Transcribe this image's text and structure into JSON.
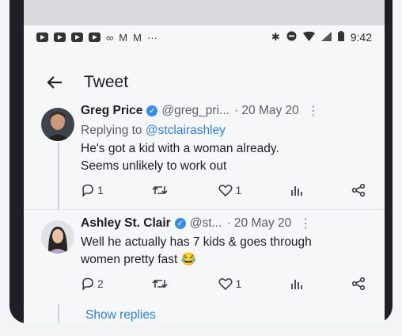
{
  "status_bar": {
    "time": "9:42",
    "icons": [
      "youtube-icon",
      "youtube-icon",
      "youtube-icon",
      "youtube-icon",
      "voicemail-icon",
      "gmail-icon",
      "gmail-icon",
      "more-dots-icon",
      "bluetooth-icon",
      "dnd-icon",
      "wifi-icon",
      "signal-icon",
      "battery-icon"
    ],
    "more_glyph": "···"
  },
  "header": {
    "title": "Tweet"
  },
  "tweets": [
    {
      "name": "Greg Price",
      "handle": "@greg_pri...",
      "date": "· 20 May 20",
      "replying_prefix": "Replying to ",
      "replying_handle": "@stclairashley",
      "text_line1": "He's got a kid with a woman already.",
      "text_line2": "Seems unlikely to work out",
      "replies": "1",
      "retweets": "",
      "likes": "1"
    },
    {
      "name": "Ashley St. Clair",
      "handle": "@st...",
      "date": "· 20 May 20",
      "text_line1": "Well he actually has 7 kids & goes through",
      "text_line2": "women pretty fast 😂",
      "replies": "2",
      "retweets": "",
      "likes": "1"
    }
  ],
  "show_replies": "Show replies",
  "colors": {
    "accent": "#2f7fd6",
    "verified": "#3a8de6",
    "text": "#1b1d21"
  }
}
